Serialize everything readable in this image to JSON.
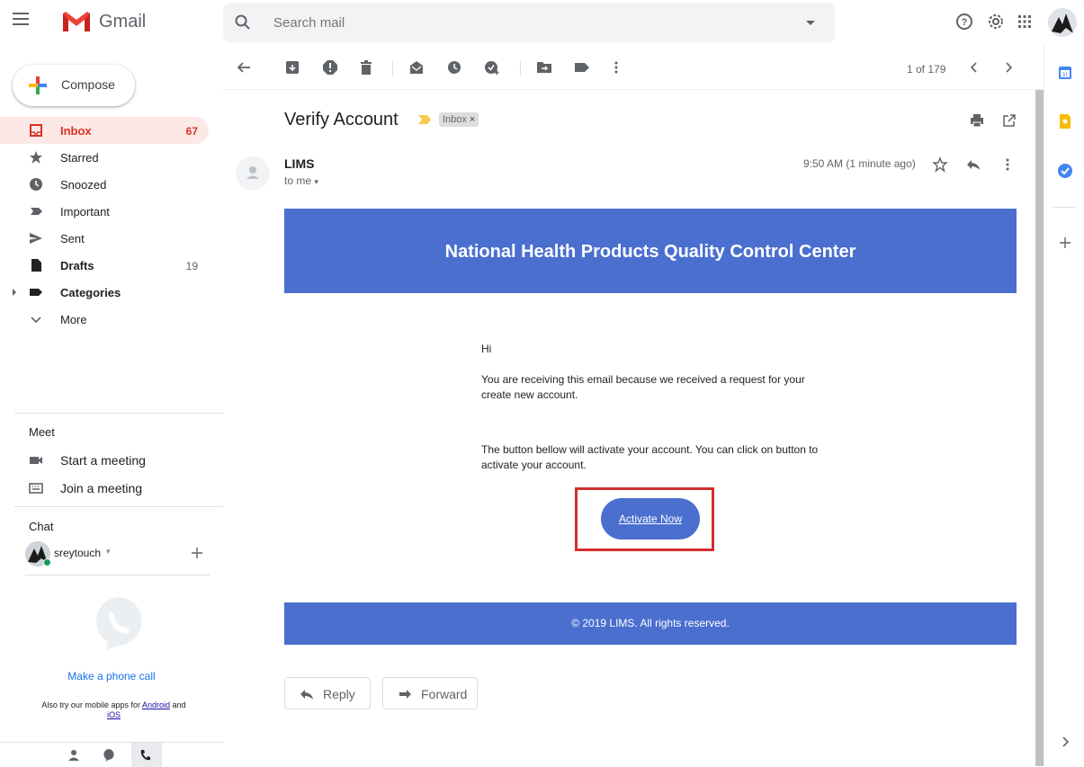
{
  "topbar": {
    "app_name": "Gmail",
    "search_placeholder": "Search mail",
    "icons": [
      "menu-icon",
      "search-icon",
      "search-options-icon",
      "help-icon",
      "settings-icon",
      "apps-icon",
      "account-avatar"
    ]
  },
  "sidebar": {
    "compose_label": "Compose",
    "nav": [
      {
        "label": "Inbox",
        "count": "67",
        "icon": "inbox-icon",
        "active": true
      },
      {
        "label": "Starred",
        "count": "",
        "icon": "star-icon"
      },
      {
        "label": "Snoozed",
        "count": "",
        "icon": "clock-icon"
      },
      {
        "label": "Important",
        "count": "",
        "icon": "important-icon"
      },
      {
        "label": "Sent",
        "count": "",
        "icon": "send-icon"
      },
      {
        "label": "Drafts",
        "count": "19",
        "icon": "draft-icon",
        "bold": true
      },
      {
        "label": "Categories",
        "count": "",
        "icon": "label-icon",
        "bold": true
      },
      {
        "label": "More",
        "count": "",
        "icon": "chevron-down-icon"
      }
    ],
    "meet": {
      "title": "Meet",
      "start": "Start a meeting",
      "join": "Join a meeting"
    },
    "chat": {
      "title": "Chat",
      "user": "sreytouch",
      "phone_call": "Make a phone call",
      "mobile_prefix": "Also try our mobile apps for",
      "android": "Android",
      "and": "and",
      "ios": "iOS"
    }
  },
  "toolbar": {
    "pager": "1 of 179"
  },
  "email": {
    "subject": "Verify Account",
    "label_chip": "Inbox",
    "label_chip_close": "×",
    "sender": "LIMS",
    "to": "to me",
    "time": "9:50 AM (1 minute ago)",
    "banner_title": "National Health Products Quality Control Center",
    "greeting": "Hi",
    "para1": "You are receiving this email because we received a request for your create new account.",
    "para2": "The button bellow will activate your account. You can click on button to activate your account.",
    "activate_label": "Activate Now",
    "footer": "© 2019 LIMS. All rights reserved.",
    "reply_label": "Reply",
    "forward_label": "Forward"
  },
  "colors": {
    "banner": "#4a6fcf",
    "inbox_active": "#d93025",
    "highlight_box": "#d32f2f"
  }
}
